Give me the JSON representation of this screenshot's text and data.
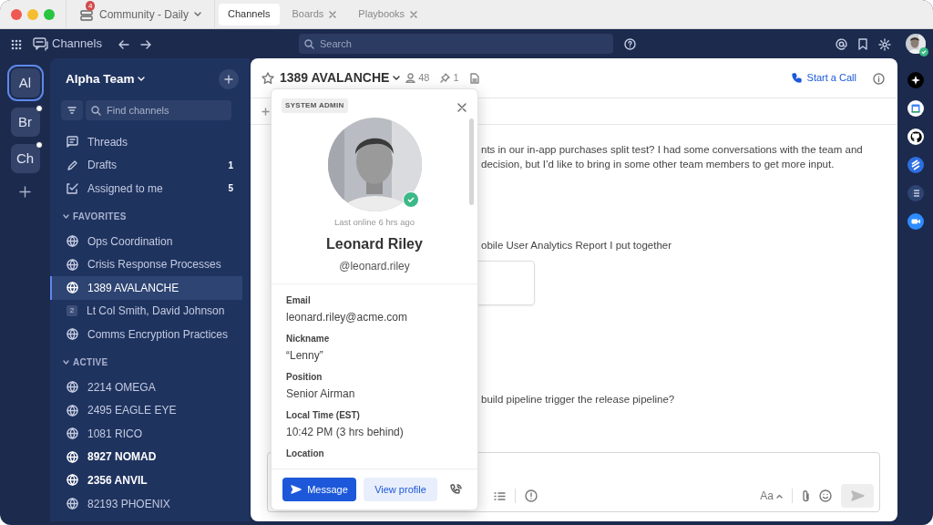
{
  "server": {
    "name": "Community - Daily",
    "badge": "4"
  },
  "tabs": [
    {
      "label": "Channels",
      "selected": true,
      "closable": false
    },
    {
      "label": "Boards",
      "selected": false,
      "closable": true
    },
    {
      "label": "Playbooks",
      "selected": false,
      "closable": true
    }
  ],
  "topbar": {
    "title": "Channels",
    "search_placeholder": "Search",
    "online": true
  },
  "teams": [
    {
      "initials": "Al",
      "selected": true,
      "unread": false
    },
    {
      "initials": "Br",
      "selected": false,
      "unread": true
    },
    {
      "initials": "Ch",
      "selected": false,
      "unread": true
    }
  ],
  "sidebar": {
    "team": "Alpha Team",
    "filter_placeholder": "Find channels",
    "nav": [
      {
        "kind": "threads",
        "label": "Threads"
      },
      {
        "kind": "drafts",
        "label": "Drafts",
        "count": "1"
      },
      {
        "kind": "assigned",
        "label": "Assigned to me",
        "count": "5"
      }
    ],
    "sections": [
      {
        "title": "FAVORITES",
        "expanded": true,
        "channels": [
          {
            "kind": "public",
            "name": "Ops Coordination",
            "selected": false,
            "unread": false
          },
          {
            "kind": "public",
            "name": "Crisis Response Processes",
            "selected": false,
            "unread": false
          },
          {
            "kind": "public",
            "name": "1389 AVALANCHE",
            "selected": true,
            "unread": false
          },
          {
            "kind": "group",
            "count": "2",
            "name": "Lt Col Smith, David Johnson",
            "selected": false,
            "unread": false
          },
          {
            "kind": "public",
            "name": "Comms Encryption Practices",
            "selected": false,
            "unread": false
          }
        ]
      },
      {
        "title": "ACTIVE",
        "expanded": true,
        "channels": [
          {
            "kind": "public",
            "name": "2214 OMEGA",
            "selected": false,
            "unread": false
          },
          {
            "kind": "public",
            "name": "2495 EAGLE EYE",
            "selected": false,
            "unread": false
          },
          {
            "kind": "public",
            "name": "1081 RICO",
            "selected": false,
            "unread": false
          },
          {
            "kind": "public",
            "name": "8927 NOMAD",
            "selected": false,
            "unread": true
          },
          {
            "kind": "public",
            "name": "2356 ANVIL",
            "selected": false,
            "unread": true
          },
          {
            "kind": "public",
            "name": "82193 PHOENIX",
            "selected": false,
            "unread": false
          }
        ]
      }
    ]
  },
  "channel_header": {
    "name": "1389 AVALANCHE",
    "members": "48",
    "pinned": "1",
    "call_label": "Start a Call"
  },
  "messages": [
    {
      "text": "nts in our in-app purchases split test? I had some conversations with the team and decision, but I’d like to bring in some other team members to get more input.",
      "attachment": false
    },
    {
      "text": "obile User Analytics Report I put together",
      "attachment": true
    },
    {
      "text": "build pipeline trigger the release pipeline?",
      "attachment": false
    }
  ],
  "composer": {
    "format_label": "Aa"
  },
  "profile": {
    "role": "SYSTEM ADMIN",
    "online": true,
    "last_online": "Last online 6 hrs ago",
    "name": "Leonard Riley",
    "username": "@leonard.riley",
    "fields": [
      {
        "label": "Email",
        "value": "leonard.riley@acme.com"
      },
      {
        "label": "Nickname",
        "value": "“Lenny”"
      },
      {
        "label": "Position",
        "value": "Senior Airman"
      },
      {
        "label": "Local Time (EST)",
        "value": "10:42 PM (3 hrs behind)"
      },
      {
        "label": "Location"
      }
    ],
    "message_button": "Message",
    "view_button": "View profile"
  },
  "app_bar": [
    {
      "kind": "sparkle"
    },
    {
      "kind": "calendar"
    },
    {
      "kind": "octo"
    },
    {
      "kind": "stripes"
    },
    {
      "kind": "list"
    },
    {
      "kind": "camera"
    }
  ]
}
